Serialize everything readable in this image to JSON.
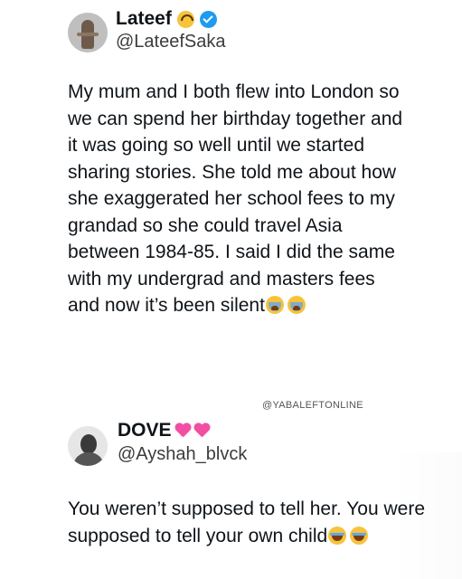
{
  "tweet1": {
    "author_name": "Lateef",
    "author_handle": "@LateefSaka",
    "name_emoji_icon": "upside-down-face-icon",
    "verified_icon": "verified-badge-icon",
    "text": "My mum and I both flew into London so we can spend her birthday together and it was going so well until we started sharing stories. She told me about how she exaggerated her school fees to my grandad so she could travel Asia between 1984-85. I said I did the same with my undergrad and masters fees and now it’s been silent",
    "text_emojis": [
      "loudly-crying-face-icon",
      "loudly-crying-face-icon"
    ]
  },
  "watermark": "@YABALEFTONLINE",
  "tweet2": {
    "author_name": "DOVE",
    "name_emojis": [
      "heart-with-ribbon-icon",
      "revolving-hearts-icon"
    ],
    "author_handle": "@Ayshah_blvck",
    "text": "You weren’t supposed to tell her. You were supposed to tell your own child",
    "text_emojis": [
      "tears-of-joy-icon",
      "tears-of-joy-icon"
    ]
  },
  "colors": {
    "text": "#0f1419",
    "handle": "#3c3c3c",
    "verified": "#1d9bf0"
  }
}
